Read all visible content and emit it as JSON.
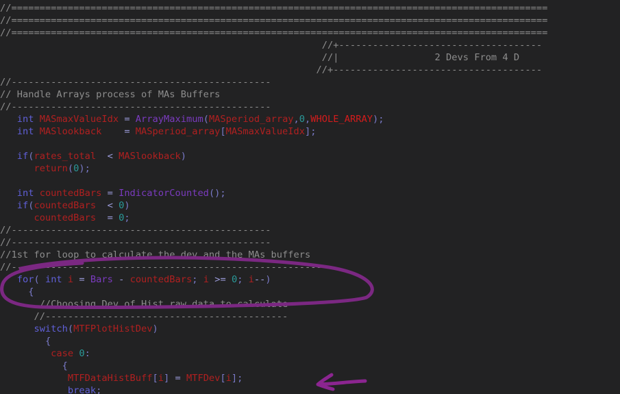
{
  "lines": [
    [
      [
        "c",
        "//==============================================================================================="
      ]
    ],
    [
      [
        "c",
        "//==============================================================================================="
      ]
    ],
    [
      [
        "c",
        "//==============================================================================================="
      ]
    ],
    [
      [
        "c",
        "                                                         //+------------------------------------"
      ]
    ],
    [
      [
        "c",
        "                                                         //|                 2 Devs From 4 D"
      ]
    ],
    [
      [
        "c",
        "                                                        //+-------------------------------------"
      ]
    ],
    [
      [
        "c",
        "//----------------------------------------------"
      ]
    ],
    [
      [
        "c",
        "// Handle Arrays process of MAs Buffers"
      ]
    ],
    [
      [
        "c",
        "//----------------------------------------------"
      ]
    ],
    [
      [
        "t",
        "   "
      ],
      [
        "k",
        "int "
      ],
      [
        "m",
        "MASmaxValueIdx "
      ],
      [
        "op",
        "= "
      ],
      [
        "f",
        "ArrayMaximum"
      ],
      [
        "p",
        "("
      ],
      [
        "m",
        "MASperiod_array"
      ],
      [
        "p",
        ","
      ],
      [
        "n",
        "0"
      ],
      [
        "p",
        ","
      ],
      [
        "r",
        "WHOLE_ARRAY"
      ],
      [
        "p",
        ");"
      ]
    ],
    [
      [
        "t",
        "   "
      ],
      [
        "k",
        "int "
      ],
      [
        "m",
        "MASlookback    "
      ],
      [
        "op",
        "= "
      ],
      [
        "m",
        "MASperiod_array"
      ],
      [
        "p",
        "["
      ],
      [
        "m",
        "MASmaxValueIdx"
      ],
      [
        "p",
        "];"
      ]
    ],
    [
      [
        "t",
        ""
      ]
    ],
    [
      [
        "t",
        "   "
      ],
      [
        "k",
        "if"
      ],
      [
        "p",
        "("
      ],
      [
        "m",
        "rates_total  "
      ],
      [
        "op",
        "< "
      ],
      [
        "m",
        "MASlookback"
      ],
      [
        "p",
        ")"
      ]
    ],
    [
      [
        "t",
        "      "
      ],
      [
        "m",
        "return"
      ],
      [
        "p",
        "("
      ],
      [
        "n",
        "0"
      ],
      [
        "p",
        ");"
      ]
    ],
    [
      [
        "t",
        ""
      ]
    ],
    [
      [
        "t",
        "   "
      ],
      [
        "k",
        "int "
      ],
      [
        "m",
        "countedBars "
      ],
      [
        "op",
        "= "
      ],
      [
        "f",
        "IndicatorCounted"
      ],
      [
        "p",
        "();"
      ]
    ],
    [
      [
        "t",
        "   "
      ],
      [
        "k",
        "if"
      ],
      [
        "p",
        "("
      ],
      [
        "m",
        "countedBars  "
      ],
      [
        "op",
        "< "
      ],
      [
        "n",
        "0"
      ],
      [
        "p",
        ")"
      ]
    ],
    [
      [
        "t",
        "      "
      ],
      [
        "m",
        "countedBars  "
      ],
      [
        "op",
        "= "
      ],
      [
        "n",
        "0"
      ],
      [
        "p",
        ";"
      ]
    ],
    [
      [
        "c",
        "//----------------------------------------------"
      ]
    ],
    [
      [
        "c",
        "//----------------------------------------------"
      ]
    ],
    [
      [
        "c",
        "//1st for loop to calculate the dev and the MAs buffers"
      ]
    ],
    [
      [
        "c",
        "//-------------------------------------------------------"
      ]
    ],
    [
      [
        "t",
        "   "
      ],
      [
        "k",
        "for"
      ],
      [
        "p",
        "( "
      ],
      [
        "k",
        "int "
      ],
      [
        "m",
        "i "
      ],
      [
        "op",
        "= "
      ],
      [
        "f",
        "Bars "
      ],
      [
        "op",
        "- "
      ],
      [
        "m",
        "countedBars"
      ],
      [
        "p",
        "; "
      ],
      [
        "m",
        "i "
      ],
      [
        "op",
        ">= "
      ],
      [
        "n",
        "0"
      ],
      [
        "p",
        "; "
      ],
      [
        "m",
        "i"
      ],
      [
        "op",
        "--"
      ],
      [
        "p",
        ")"
      ]
    ],
    [
      [
        "t",
        "     "
      ],
      [
        "p",
        "{"
      ]
    ],
    [
      [
        "t",
        "       "
      ],
      [
        "c",
        "//Choosing Dev of Hist raw data to calculate"
      ]
    ],
    [
      [
        "t",
        "      "
      ],
      [
        "c",
        "//-------------------------------------------"
      ]
    ],
    [
      [
        "t",
        "      "
      ],
      [
        "k",
        "switch"
      ],
      [
        "p",
        "("
      ],
      [
        "m",
        "MTFPlotHistDev"
      ],
      [
        "p",
        ")"
      ]
    ],
    [
      [
        "t",
        "        "
      ],
      [
        "p",
        "{"
      ]
    ],
    [
      [
        "t",
        "         "
      ],
      [
        "m",
        "case "
      ],
      [
        "n",
        "0"
      ],
      [
        "p",
        ":"
      ]
    ],
    [
      [
        "t",
        "           "
      ],
      [
        "p",
        "{"
      ]
    ],
    [
      [
        "t",
        "            "
      ],
      [
        "m",
        "MTFDataHistBuff"
      ],
      [
        "p",
        "["
      ],
      [
        "m",
        "i"
      ],
      [
        "p",
        "] "
      ],
      [
        "op",
        "= "
      ],
      [
        "m",
        "MTFDev"
      ],
      [
        "p",
        "["
      ],
      [
        "m",
        "i"
      ],
      [
        "p",
        "];"
      ]
    ],
    [
      [
        "t",
        "            "
      ],
      [
        "k",
        "break"
      ],
      [
        "p",
        ";"
      ]
    ]
  ]
}
